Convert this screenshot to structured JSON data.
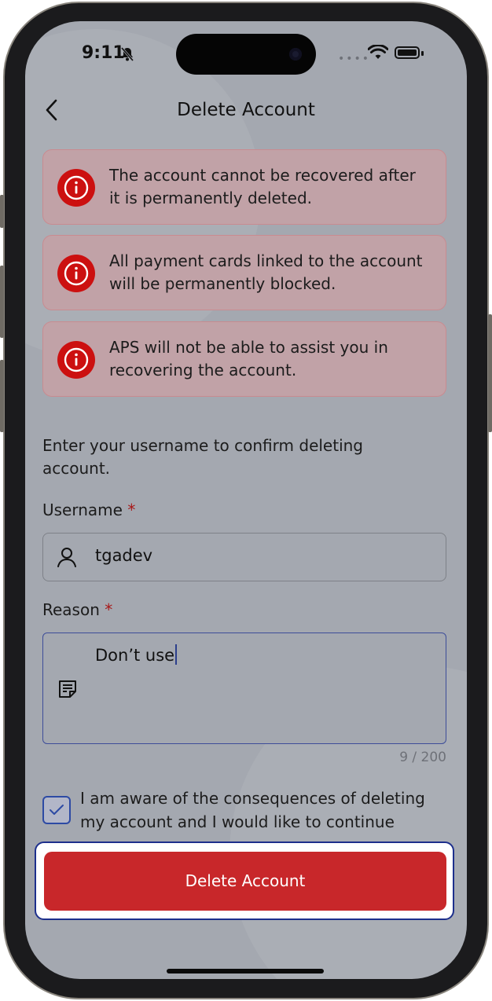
{
  "status": {
    "time": "9:11"
  },
  "nav": {
    "title": "Delete Account"
  },
  "warnings": [
    {
      "text": "The account cannot be recovered after it is permanently deleted."
    },
    {
      "text": "All payment cards linked to the account will be permanently blocked."
    },
    {
      "text": "APS will not be able to assist you in recovering the account."
    }
  ],
  "form": {
    "prompt": "Enter your username to confirm deleting account.",
    "username": {
      "label": "Username",
      "required_mark": "*",
      "value": "tgadev"
    },
    "reason": {
      "label": "Reason",
      "required_mark": "*",
      "value": "Don’t use",
      "counter": "9 / 200"
    },
    "agree": {
      "checked": true,
      "text": "I am aware of the consequences of deleting my account and I would like to continue"
    }
  },
  "actions": {
    "delete_label": "Delete Account"
  },
  "colors": {
    "danger": "#cc1010",
    "button": "#c8272a",
    "focus": "#3d4d99"
  },
  "icons": [
    "back-chevron-icon",
    "bell-slash-icon",
    "wifi-icon",
    "battery-icon",
    "info-icon",
    "user-icon",
    "note-icon",
    "check-icon"
  ]
}
